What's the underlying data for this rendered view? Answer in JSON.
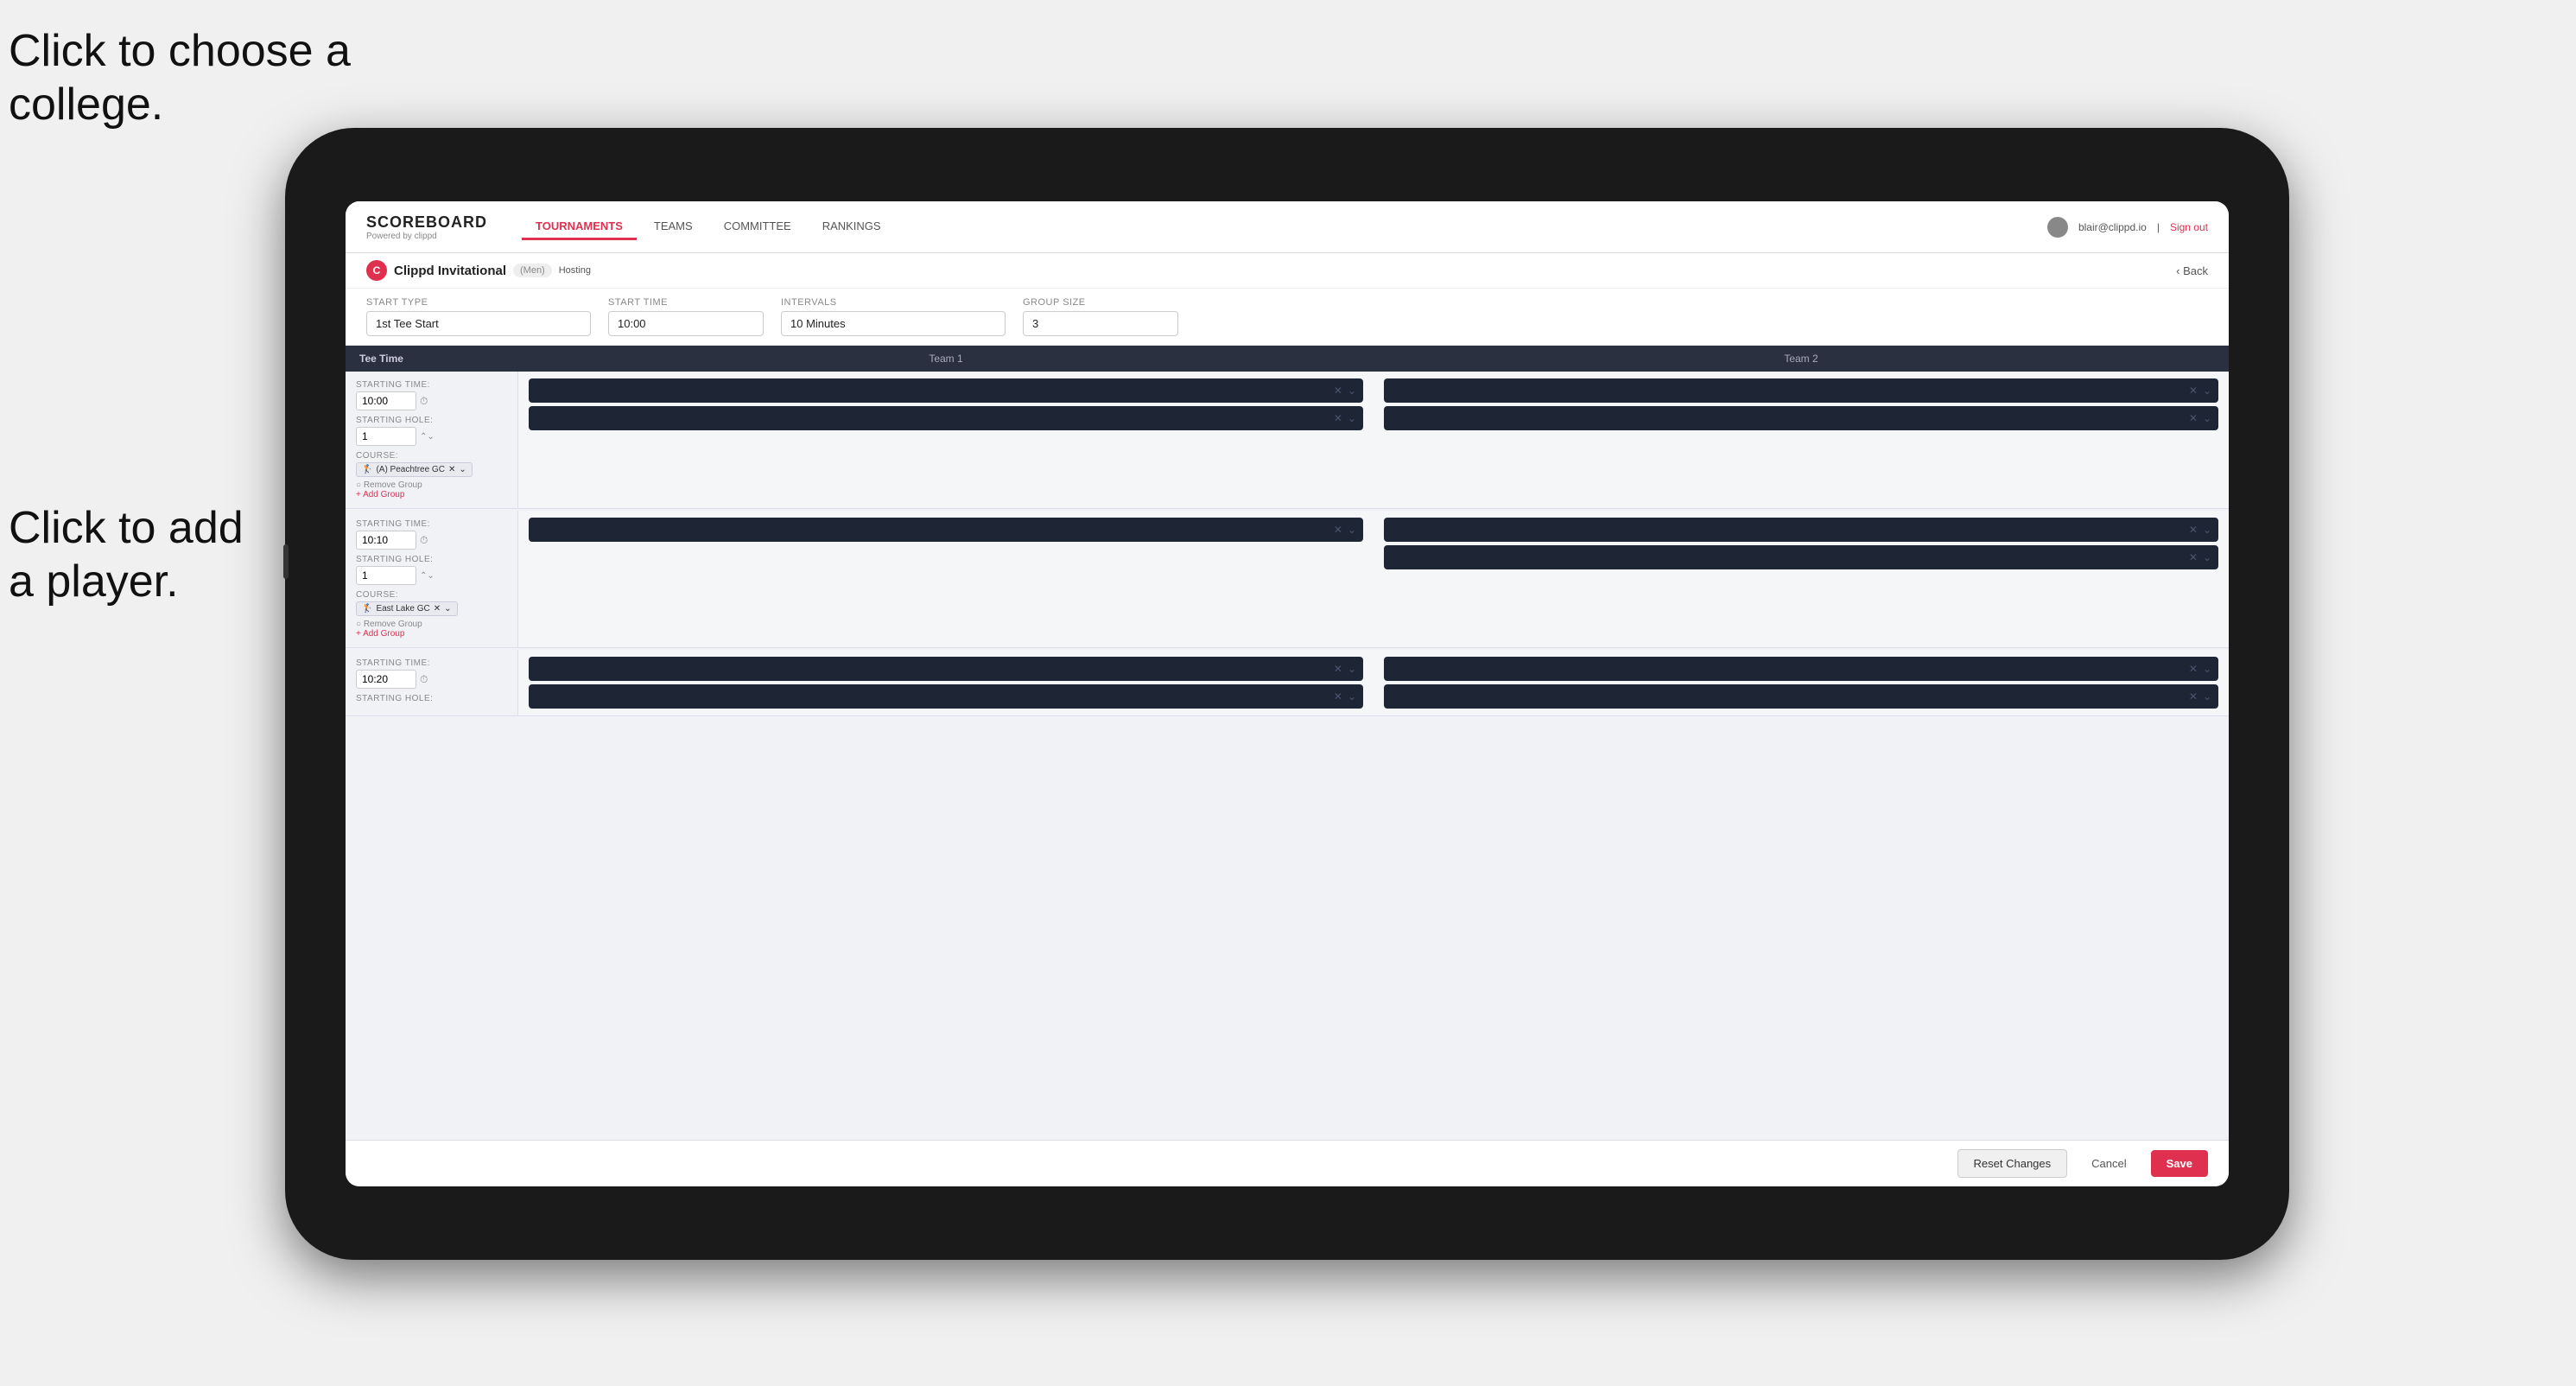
{
  "annotations": {
    "text1_line1": "Click to choose a",
    "text1_line2": "college.",
    "text2_line1": "Click to add",
    "text2_line2": "a player."
  },
  "nav": {
    "brand": "SCOREBOARD",
    "brand_sub": "Powered by clippd",
    "links": [
      "TOURNAMENTS",
      "TEAMS",
      "COMMITTEE",
      "RANKINGS"
    ],
    "active_link": "TOURNAMENTS",
    "user_email": "blair@clippd.io",
    "sign_out": "Sign out"
  },
  "sub_header": {
    "event_name": "Clippd Invitational",
    "event_type": "(Men)",
    "hosting": "Hosting",
    "back": "Back"
  },
  "form": {
    "start_type_label": "Start Type",
    "start_type_value": "1st Tee Start",
    "start_time_label": "Start Time",
    "start_time_value": "10:00",
    "intervals_label": "Intervals",
    "intervals_value": "10 Minutes",
    "group_size_label": "Group Size",
    "group_size_value": "3"
  },
  "table": {
    "col1": "Tee Time",
    "col2": "Team 1",
    "col3": "Team 2"
  },
  "groups": [
    {
      "starting_time": "10:00",
      "starting_hole": "1",
      "course": "(A) Peachtree GC",
      "players_team1": 2,
      "players_team2": 2,
      "show_course": true
    },
    {
      "starting_time": "10:10",
      "starting_hole": "1",
      "course": "East Lake GC",
      "players_team1": 1,
      "players_team2": 2,
      "show_course": true
    },
    {
      "starting_time": "10:20",
      "starting_hole": "",
      "course": "",
      "players_team1": 2,
      "players_team2": 2,
      "show_course": false
    }
  ],
  "footer": {
    "reset_label": "Reset Changes",
    "cancel_label": "Cancel",
    "save_label": "Save"
  }
}
